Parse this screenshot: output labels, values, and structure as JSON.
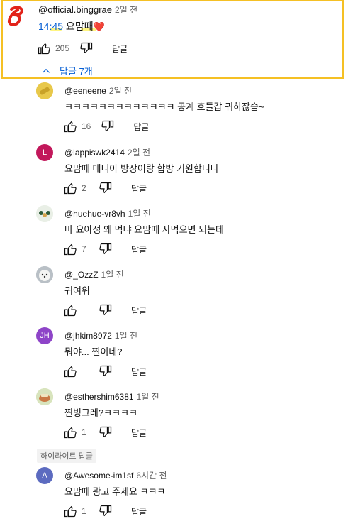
{
  "top_comment": {
    "author": "@official.binggrae",
    "time": "2일 전",
    "timestamp_link": "14:45",
    "text": " 요맘때",
    "heart": "❤️",
    "likes": "205",
    "reply_label": "답글",
    "replies_toggle": "답글 7개"
  },
  "replies": [
    {
      "author": "@eeneene",
      "time": "2일 전",
      "text": "ㅋㅋㅋㅋㅋㅋㅋㅋㅋㅋㅋㅋㅋ 공계  호들갑 귀하잖슴~",
      "likes": "16",
      "reply_label": "답글",
      "avatar_color": "#e8c84a",
      "avatar_letter": ""
    },
    {
      "author": "@lappiswk2414",
      "time": "2일 전",
      "text": "요맘때 매니아 방장이랑 합방 기원합니다",
      "likes": "2",
      "reply_label": "답글",
      "avatar_color": "#c2185b",
      "avatar_letter": "L"
    },
    {
      "author": "@huehue-vr8vh",
      "time": "1일 전",
      "text": "마 요아정 왜 먹냐 요맘때 사먹으면 되는데",
      "likes": "7",
      "reply_label": "답글",
      "avatar_color": "#e9efe6",
      "avatar_letter": ""
    },
    {
      "author": "@_OzzZ",
      "time": "1일 전",
      "text": "귀여워",
      "likes": "",
      "reply_label": "답글",
      "avatar_color": "#b9c0c6",
      "avatar_letter": ""
    },
    {
      "author": "@jhkim8972",
      "time": "1일 전",
      "text": "뭐야... 찐이네?",
      "likes": "",
      "reply_label": "답글",
      "avatar_color": "#8e44c8",
      "avatar_letter": "JH"
    },
    {
      "author": "@esthershim6381",
      "time": "1일 전",
      "text": "찐빙그레?ㅋㅋㅋㅋ",
      "likes": "1",
      "reply_label": "답글",
      "avatar_color": "#c9d9a8",
      "avatar_letter": ""
    },
    {
      "author": "@Awesome-im1sf",
      "time": "6시간 전",
      "text": "요맘때 광고 주세요 ㅋㅋㅋ",
      "likes": "1",
      "reply_label": "답글",
      "avatar_color": "#5c6bc0",
      "avatar_letter": "A"
    }
  ],
  "highlight_badge": "하이라이트 답글",
  "colors": {
    "highlight_border": "#f5c024",
    "link": "#065fd4",
    "logo_red": "#e2231a"
  }
}
